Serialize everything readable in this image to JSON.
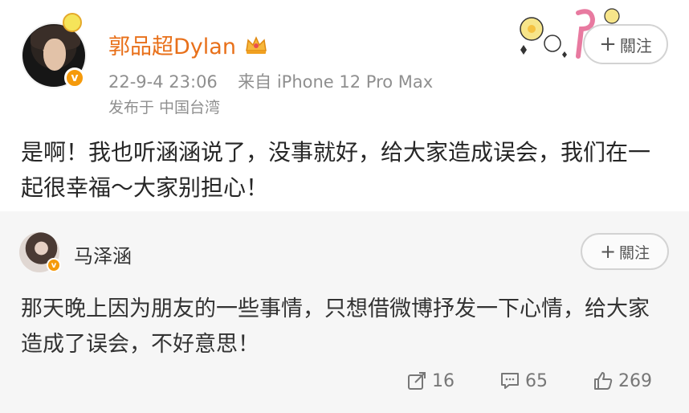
{
  "post": {
    "username": "郭品超Dylan",
    "timestamp": "22-9-4 23:06",
    "source": "来自 iPhone 12 Pro Max",
    "location": "发布于 中国台湾",
    "follow_label": "關注",
    "follow_plus": "+",
    "text": "是啊！我也听涵涵说了，没事就好，给大家造成误会，我们在一起很幸福～大家别担心！",
    "verified_badge": "v",
    "icons": {
      "avatar": "user-avatar",
      "crown": "crown-icon",
      "decoration": "sticker-decoration",
      "headwear": "avatar-pendant"
    }
  },
  "repost": {
    "username": "马泽涵",
    "follow_label": "關注",
    "follow_plus": "+",
    "text": "那天晚上因为朋友的一些事情，只想借微博抒发一下心情，给大家造成了误会，不好意思！",
    "verified_badge": "v",
    "actions": {
      "share_count": "16",
      "comment_count": "65",
      "like_count": "269"
    },
    "icons": {
      "share": "share-icon",
      "comment": "comment-icon",
      "like": "like-icon"
    }
  },
  "colors": {
    "username": "#e8701a",
    "verified": "#f59a0b",
    "meta": "#8f8f8f",
    "repost_bg": "#f6f6f6"
  }
}
